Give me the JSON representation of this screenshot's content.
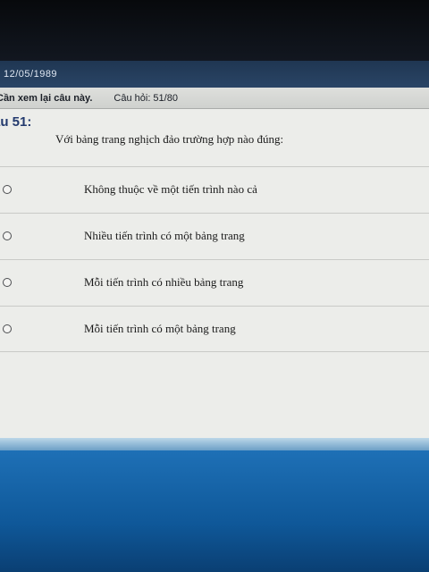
{
  "window": {
    "date": "12/05/1989"
  },
  "info": {
    "review_label": "Cần xem lại câu này.",
    "counter": "Câu hỏi: 51/80"
  },
  "question": {
    "number_label": "âu 51:",
    "text": "Với bảng trang nghịch đảo trường hợp nào đúng:"
  },
  "options": [
    {
      "label": "Không thuộc về một tiến trình nào cả"
    },
    {
      "label": "Nhiều tiến trình có một bảng trang"
    },
    {
      "label": "Mỗi tiến trình có nhiều bảng trang"
    },
    {
      "label": "Mỗi tiến trình có một bảng trang"
    }
  ]
}
